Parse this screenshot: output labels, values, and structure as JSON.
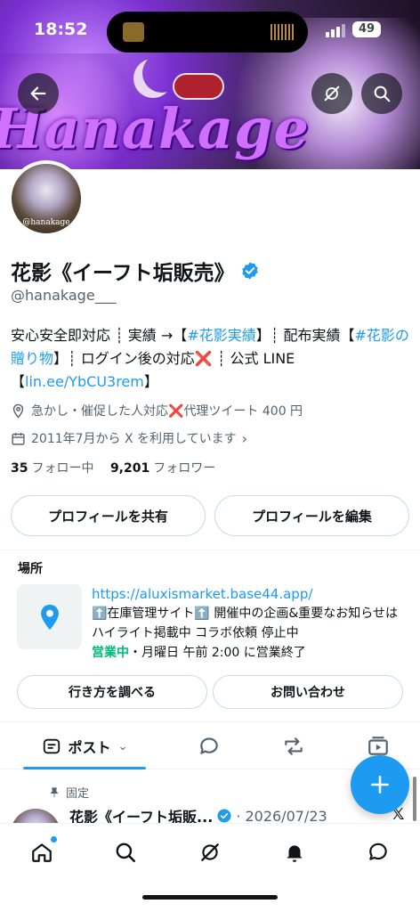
{
  "status_bar": {
    "time": "18:52",
    "battery": "49"
  },
  "banner": {
    "wordmark": "Hanakage"
  },
  "avatar": {
    "tag": "@hanakage"
  },
  "profile": {
    "name": "花影《イーフト垢販売》",
    "handle": "@hanakage___",
    "bio": {
      "p1": "安心安全即対応 ┊ 実績 →【",
      "tag1": "#花影実績",
      "p2": "】┊ 配布実績【",
      "tag2": "#花影の贈り物",
      "p3": "】┊ ログイン後の対応",
      "xmark": "❌",
      "p4": " ┊ 公式 LINE【",
      "line_link": "lin.ee/YbCU3rem",
      "p5": "】"
    },
    "location": {
      "text1": "急かし・催促した人対応",
      "xmark": "❌",
      "text2": "代理ツイート 400 円"
    },
    "joined": "2011年7月から X を利用しています",
    "following_count": "35",
    "following_label": "フォロー中",
    "followers_count": "9,201",
    "followers_label": "フォロワー"
  },
  "buttons": {
    "share": "プロフィールを共有",
    "edit": "プロフィールを編集"
  },
  "business": {
    "section_title": "場所",
    "url": "https://aluxismarket.base44.app/",
    "desc": "⬆️在庫管理サイト⬆️ 開催中の企画&重要なお知らせはハイライト掲載中 コラボ依頼 停止中",
    "open_label": "営業中",
    "hours": "・月曜日 午前 2:00 に営業終了",
    "directions": "行き方を調べる",
    "contact": "お問い合わせ"
  },
  "tabs": {
    "posts_label": "ポスト"
  },
  "pinned_post": {
    "pinned_label": "固定",
    "author": "花影《イーフト垢販...",
    "date": "· 2026/07/23"
  },
  "colors": {
    "accent": "#1d9bf0",
    "open": "#00ba7c",
    "xmark": "#e0245e"
  }
}
